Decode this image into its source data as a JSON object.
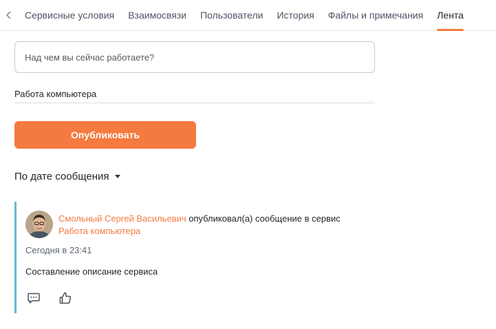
{
  "tabs": {
    "items": [
      {
        "label": "Сервисные условия"
      },
      {
        "label": "Взаимосвязи"
      },
      {
        "label": "Пользователи"
      },
      {
        "label": "История"
      },
      {
        "label": "Файлы и примечания"
      },
      {
        "label": "Лента"
      }
    ],
    "active": "Лента"
  },
  "composer": {
    "placeholder": "Над чем вы сейчас работаете?",
    "value": "",
    "service_value": "Работа компьютера",
    "publish_label": "Опубликовать"
  },
  "sort": {
    "label": "По дате сообщения"
  },
  "post": {
    "author": "Смольный Сергей Васильевич",
    "action_text": " опубликовал(а) сообщение в сервис ",
    "service": "Работа компьютера",
    "time": "Сегодня в 23:41",
    "body": "Составление описание сервиса",
    "icons": [
      "comment-icon",
      "like-icon"
    ]
  },
  "colors": {
    "accent": "#f47a3f",
    "post_border": "#6bb7d6"
  }
}
